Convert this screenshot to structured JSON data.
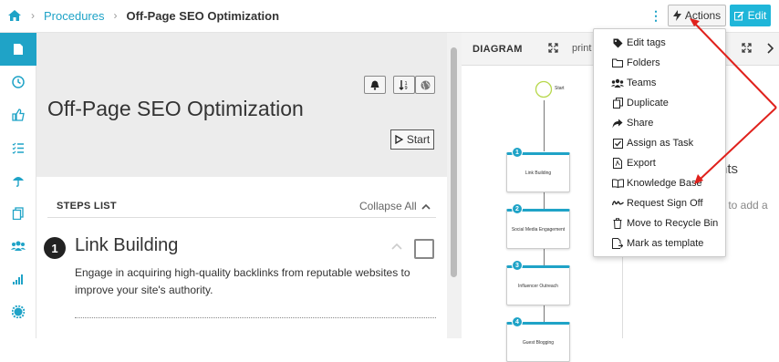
{
  "breadcrumb": {
    "root_icon": "home-icon",
    "link": "Procedures",
    "current": "Off-Page SEO Optimization"
  },
  "toolbar": {
    "actions_label": "Actions",
    "edit_label": "Edit",
    "accent": "#1fa3c7"
  },
  "sidebar": {
    "items": [
      {
        "icon": "document-icon",
        "active": true
      },
      {
        "icon": "clock-icon"
      },
      {
        "icon": "thumbs-up-icon"
      },
      {
        "icon": "checklist-icon"
      },
      {
        "icon": "umbrella-icon"
      },
      {
        "icon": "copy-icon"
      },
      {
        "icon": "users-icon"
      },
      {
        "icon": "signal-bars-icon"
      },
      {
        "icon": "gear-icon"
      }
    ]
  },
  "procedure": {
    "title": "Off-Page SEO Optimization",
    "start_label": "Start"
  },
  "steps": {
    "header": "STEPS LIST",
    "collapse_label": "Collapse All",
    "items": [
      {
        "number": "1",
        "title": "Link Building",
        "description": "Engage in acquiring high-quality backlinks from reputable websites to improve your site's authority."
      }
    ]
  },
  "diagram": {
    "title": "DIAGRAM",
    "print_label": "print",
    "start_label": "Start",
    "nodes": [
      {
        "number": "1",
        "label": "Link Building"
      },
      {
        "number": "2",
        "label": "Social Media Engagement"
      },
      {
        "number": "3",
        "label": "Influencer Outreach"
      },
      {
        "number": "4",
        "label": "Guest Blogging"
      }
    ]
  },
  "comments": {
    "title_fragment": "nts",
    "hint_fragment": "y to add a"
  },
  "actions_menu": {
    "items": [
      {
        "label": "Edit tags",
        "icon": "tag-icon"
      },
      {
        "label": "Folders",
        "icon": "folder-icon"
      },
      {
        "label": "Teams",
        "icon": "users-icon"
      },
      {
        "label": "Duplicate",
        "icon": "duplicate-icon"
      },
      {
        "label": "Share",
        "icon": "share-icon"
      },
      {
        "label": "Assign as Task",
        "icon": "check-square-icon"
      },
      {
        "label": "Export",
        "icon": "pdf-file-icon"
      },
      {
        "label": "Knowledge Base",
        "icon": "book-icon"
      },
      {
        "label": "Request Sign Off",
        "icon": "signature-icon"
      },
      {
        "label": "Move to Recycle Bin",
        "icon": "trash-icon"
      },
      {
        "label": "Mark as template",
        "icon": "template-icon"
      }
    ]
  },
  "annotation_color": "#e0211c"
}
